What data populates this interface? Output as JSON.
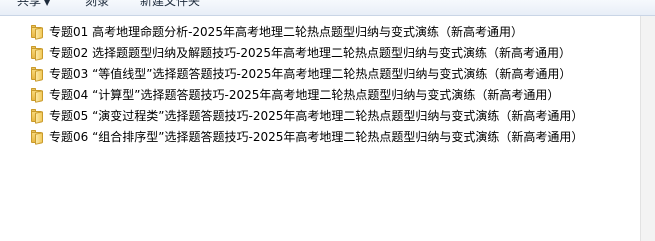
{
  "toolbar": {
    "share_label": "共享",
    "burn_label": "刻录",
    "new_folder_label": "新建文件夹"
  },
  "files": [
    {
      "name": "专题01 高考地理命题分析-2025年高考地理二轮热点题型归纳与变式演练（新高考通用）",
      "icon": "folder-icon"
    },
    {
      "name": "专题02 选择题题型归纳及解题技巧-2025年高考地理二轮热点题型归纳与变式演练（新高考通用）",
      "icon": "folder-icon"
    },
    {
      "name": "专题03 “等值线型”选择题答题技巧-2025年高考地理二轮热点题型归纳与变式演练（新高考通用）",
      "icon": "folder-icon"
    },
    {
      "name": "专题04 “计算型”选择题答题技巧-2025年高考地理二轮热点题型归纳与变式演练（新高考通用）",
      "icon": "folder-icon"
    },
    {
      "name": "专题05 “演变过程类”选择题答题技巧-2025年高考地理二轮热点题型归纳与变式演练（新高考通用）",
      "icon": "folder-icon"
    },
    {
      "name": "专题06 “组合排序型”选择题答题技巧-2025年高考地理二轮热点题型归纳与变式演练（新高考通用）",
      "icon": "folder-icon"
    }
  ]
}
